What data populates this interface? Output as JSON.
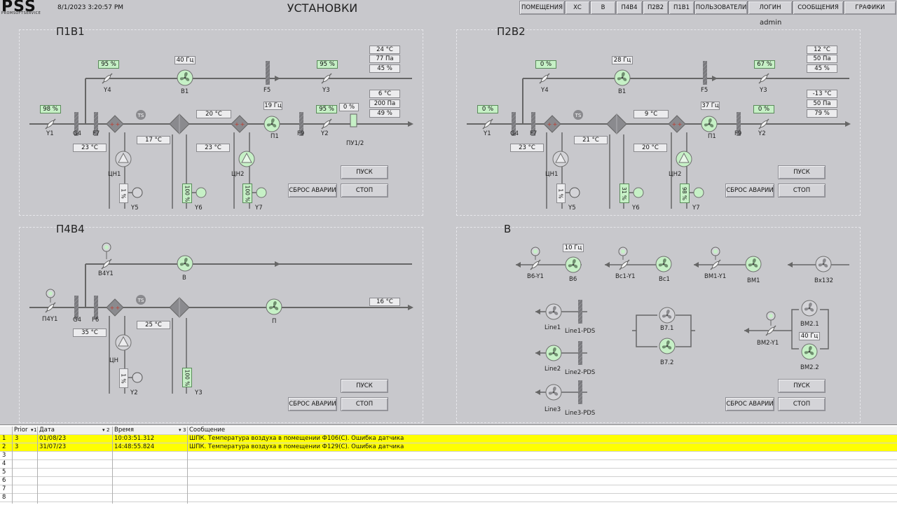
{
  "header": {
    "logo": "PSS",
    "logo_sub": "PROMSOFTSERVICE",
    "datetime": "8/1/2023 3:20:57 PM",
    "title": "УСТАНОВКИ",
    "user": "admin",
    "nav": [
      "ПОМЕЩЕНИЯ",
      "ХС",
      "В",
      "П4В4",
      "П2В2",
      "П1В1",
      "ПОЛЬЗОВАТЕЛИ",
      "ЛОГИН",
      "СООБЩЕНИЯ",
      "ГРАФИКИ"
    ]
  },
  "p1": {
    "title": "П1В1",
    "y4": "95 %",
    "y3": "95 %",
    "y1": "98 %",
    "y2": "95 %",
    "pu": "0 %",
    "b1_freq": "40 Гц",
    "p1_freq": "19 Гц",
    "t_mid": "20 °C",
    "t_out1": "24 °C",
    "p_out1": "77 Па",
    "h_out1": "45 %",
    "t_out2": "6 °C",
    "p_out2": "200 Па",
    "h_out2": "49 %",
    "t_a": "23 °C",
    "t_b": "17 °C",
    "t_c": "23 °C",
    "v_cn1": "1 %",
    "v_y6": "100 %",
    "v_y7": "100 %",
    "labels": {
      "y4": "Y4",
      "b1": "B1",
      "f5": "F5",
      "y3": "Y3",
      "y1": "Y1",
      "g4": "G4",
      "f7": "F7",
      "ts": "TS",
      "p1": "П1",
      "f9": "F9",
      "y2": "Y2",
      "pu": "ПУ1/2",
      "cn1": "ЦН1",
      "cn2": "ЦН2",
      "y5": "Y5",
      "y6": "Y6",
      "y7": "Y7"
    },
    "start": "ПУСК",
    "reset": "СБРОС АВАРИИ",
    "stop": "СТОП"
  },
  "p2": {
    "title": "П2В2",
    "y4": "0 %",
    "y3": "67 %",
    "y1": "0 %",
    "y2": "0 %",
    "b1_freq": "28 Гц",
    "p1_freq": "37 Гц",
    "t_mid": "9 °C",
    "t_out1": "12 °C",
    "p_out1": "50 Па",
    "h_out1": "45 %",
    "t_out2": "-13 °C",
    "p_out2": "50 Па",
    "h_out2": "79 %",
    "t_a": "23 °C",
    "t_b": "21 °C",
    "t_c": "20 °C",
    "v_cn1": "1 %",
    "v_y6": "31 %",
    "v_y7": "98 %",
    "labels": {
      "y4": "Y4",
      "b1": "B1",
      "f5": "F5",
      "y3": "Y3",
      "y1": "Y1",
      "g4": "G4",
      "f7": "F7",
      "ts": "TS",
      "p1": "П1",
      "f9": "F9",
      "y2": "Y2",
      "cn1": "ЦН1",
      "cn2": "ЦН2",
      "y5": "Y5",
      "y6": "Y6",
      "y7": "Y7"
    },
    "start": "ПУСК",
    "reset": "СБРОС АВАРИИ",
    "stop": "СТОП"
  },
  "p4": {
    "title": "П4В4",
    "t_out": "16 °C",
    "t_a": "35 °C",
    "t_b": "25 °C",
    "v_cn": "1 %",
    "v_y3": "100 %",
    "labels": {
      "b4y1": "B4Y1",
      "b": "B",
      "p4y1": "П4Y1",
      "g4": "G4",
      "f6": "F6",
      "ts": "TS",
      "p": "П",
      "cn": "ЦН",
      "y2": "Y2",
      "y3": "Y3"
    },
    "start": "ПУСК",
    "reset": "СБРОС АВАРИИ",
    "stop": "СТОП"
  },
  "pb": {
    "title": "В",
    "b6_freq": "10 Гц",
    "bm2_freq": "40 Гц",
    "labels": {
      "b6y1": "B6-Y1",
      "b6": "B6",
      "bc1y1": "Bc1-Y1",
      "bc1": "Bc1",
      "bm1y1": "BM1-Y1",
      "bm1": "BM1",
      "bx132": "Bx132",
      "line1": "Line1",
      "line1pds": "Line1-PDS",
      "line2": "Line2",
      "line2pds": "Line2-PDS",
      "line3": "Line3",
      "line3pds": "Line3-PDS",
      "b71": "B7.1",
      "b72": "B7.2",
      "bm2y1": "BM2-Y1",
      "bm21": "BM2.1",
      "bm22": "BM2.2"
    },
    "start": "ПУСК",
    "reset": "СБРОС АВАРИИ",
    "stop": "СТОП"
  },
  "alarms": {
    "columns": [
      "Prior",
      "Дата",
      "Время",
      "Сообщение"
    ],
    "sort_marks": [
      "1",
      "2",
      "3"
    ],
    "rows": [
      {
        "n": "1",
        "prior": "3",
        "date": "01/08/23",
        "time": "10:03:51.312",
        "msg": "ШПК. Температура воздуха в помещении Ф106(С). Ошибка датчика"
      },
      {
        "n": "2",
        "prior": "3",
        "date": "31/07/23",
        "time": "14:48:55.824",
        "msg": "ШПК. Температура воздуха в помещении Ф129(С). Ошибка датчика"
      },
      {
        "n": "3",
        "prior": "",
        "date": "",
        "time": "",
        "msg": ""
      },
      {
        "n": "4",
        "prior": "",
        "date": "",
        "time": "",
        "msg": ""
      },
      {
        "n": "5",
        "prior": "",
        "date": "",
        "time": "",
        "msg": ""
      },
      {
        "n": "6",
        "prior": "",
        "date": "",
        "time": "",
        "msg": ""
      },
      {
        "n": "7",
        "prior": "",
        "date": "",
        "time": "",
        "msg": ""
      },
      {
        "n": "8",
        "prior": "",
        "date": "",
        "time": "",
        "msg": ""
      }
    ]
  }
}
